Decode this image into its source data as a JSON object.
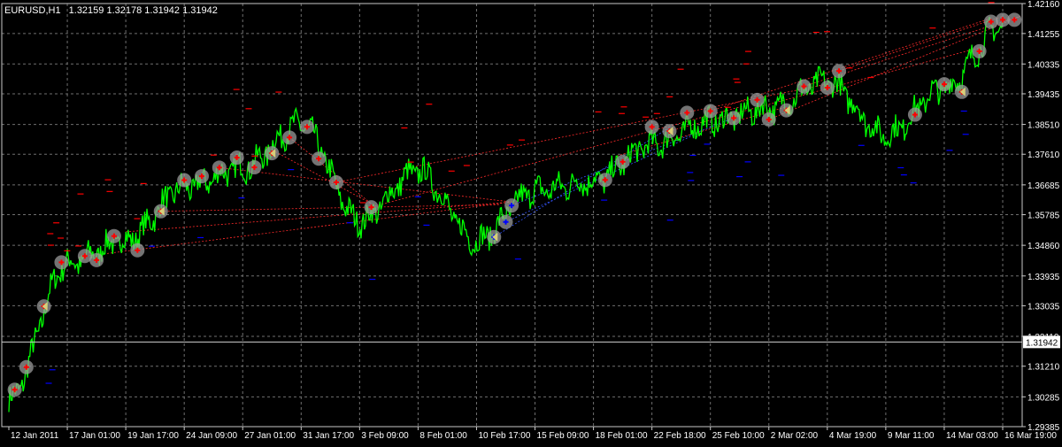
{
  "header": {
    "symbol": "EURUSD,H1",
    "ohlc": "1.32159 1.32178 1.31942 1.31942"
  },
  "colors": {
    "background": "#000000",
    "grid": "#6f6f6f",
    "price_line": "#00ff00",
    "sell_marker": "#ff0000",
    "buy_marker": "#0000ff",
    "sell_trade_line": "#ff2a2a",
    "buy_trade_line": "#3355ff",
    "marker_halo": "#9a9a9a",
    "close_arrow": "#d8cf7a",
    "axis_text": "#ffffff",
    "current_price_box": "#ffffff"
  },
  "chart_data": {
    "type": "line",
    "ylim": [
      1.29385,
      1.4216
    ],
    "y_ticks": [
      "1.42160",
      "1.41255",
      "1.40335",
      "1.39435",
      "1.38510",
      "1.37610",
      "1.36685",
      "1.35785",
      "1.34860",
      "1.33935",
      "1.33035",
      "1.32110",
      "1.31210",
      "1.30285",
      "1.29385"
    ],
    "y_tick_values": [
      1.4216,
      1.41255,
      1.40335,
      1.39435,
      1.3851,
      1.3761,
      1.36685,
      1.35785,
      1.3486,
      1.33935,
      1.33035,
      1.3211,
      1.3121,
      1.30285,
      1.29385
    ],
    "current_price": "1.31942",
    "current_price_value": 1.31942,
    "x_ticks": [
      "12 Jan 2011",
      "17 Jan 01:00",
      "19 Jan 17:00",
      "24 Jan 09:00",
      "27 Jan 01:00",
      "31 Jan 17:00",
      "3 Feb 09:00",
      "8 Feb 01:00",
      "10 Feb 17:00",
      "15 Feb 09:00",
      "18 Feb 01:00",
      "22 Feb 18:00",
      "25 Feb 10:00",
      "2 Mar 02:00",
      "4 Mar 19:00",
      "9 Mar 11:00",
      "14 Mar 03:00",
      "16 Mar 19:00"
    ],
    "series": [
      {
        "x": [
          0,
          1,
          2,
          3,
          4,
          5,
          6,
          7,
          8,
          9,
          10,
          11,
          12,
          13,
          14,
          15,
          16,
          17
        ],
        "y": [
          1.302,
          1.343,
          1.35,
          1.366,
          1.372,
          1.385,
          1.356,
          1.371,
          1.35,
          1.365,
          1.368,
          1.379,
          1.386,
          1.39,
          1.398,
          1.382,
          1.396,
          1.415
        ]
      }
    ]
  }
}
